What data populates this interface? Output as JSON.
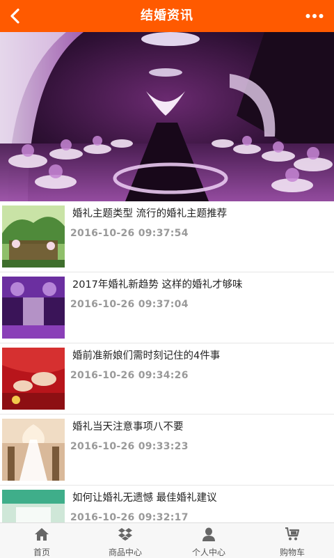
{
  "header": {
    "title": "结婚资讯",
    "back_icon": "chevron-left-icon",
    "more_icon": "more-dots-icon",
    "color": "#ff5a00"
  },
  "banner": {
    "icon": "wedding-hall-image"
  },
  "articles": [
    {
      "title": "婚礼主题类型 流行的婚礼主题推荐",
      "date": "2016-10-26 09:37:54"
    },
    {
      "title": "2017年婚礼新趋势 这样的婚礼才够味",
      "date": "2016-10-26 09:37:04"
    },
    {
      "title": "婚前准新娘们需时刻记住的4件事",
      "date": "2016-10-26 09:34:26"
    },
    {
      "title": "婚礼当天注意事项八不要",
      "date": "2016-10-26 09:33:23"
    },
    {
      "title": "如何让婚礼无遗憾 最佳婚礼建议",
      "date": "2016-10-26 09:32:17"
    }
  ],
  "tabbar": {
    "items": [
      {
        "label": "首页",
        "icon": "home-icon"
      },
      {
        "label": "商品中心",
        "icon": "dropbox-icon"
      },
      {
        "label": "个人中心",
        "icon": "user-icon"
      },
      {
        "label": "购物车",
        "icon": "cart-icon"
      }
    ]
  }
}
